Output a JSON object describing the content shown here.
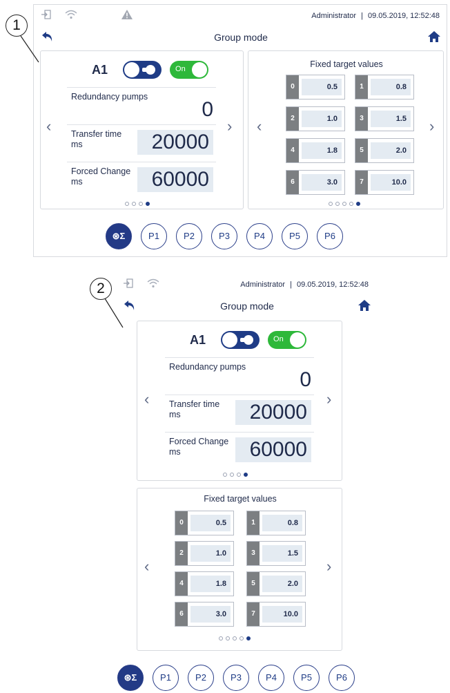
{
  "callouts": [
    "1",
    "2"
  ],
  "status": {
    "user": "Administrator",
    "separator": "|",
    "datetime": "09.05.2019, 12:52:48",
    "icons": [
      "login-icon",
      "wifi-icon",
      "warning-icon"
    ]
  },
  "header": {
    "title": "Group mode"
  },
  "group": {
    "label": "A1",
    "auto_toggle": "On"
  },
  "params": {
    "redundancy": {
      "label": "Redundancy pumps",
      "value": "0"
    },
    "transfer": {
      "label_line1": "Transfer time",
      "label_line2": "ms",
      "value": "20000"
    },
    "forced": {
      "label_line1": "Forced Change",
      "label_line2": "ms",
      "value": "60000"
    }
  },
  "fixed_targets": {
    "title": "Fixed target values",
    "items": [
      {
        "idx": "0",
        "val": "0.5"
      },
      {
        "idx": "1",
        "val": "0.8"
      },
      {
        "idx": "2",
        "val": "1.0"
      },
      {
        "idx": "3",
        "val": "1.5"
      },
      {
        "idx": "4",
        "val": "1.8"
      },
      {
        "idx": "5",
        "val": "2.0"
      },
      {
        "idx": "6",
        "val": "3.0"
      },
      {
        "idx": "7",
        "val": "10.0"
      }
    ]
  },
  "nav": {
    "prev": "‹",
    "next": "›"
  },
  "pumps": {
    "group_icon": "group-sum-icon",
    "group_label": "⊛Σ",
    "items": [
      "P1",
      "P2",
      "P3",
      "P4",
      "P5",
      "P6"
    ]
  },
  "colors": {
    "primary": "#1f3c86",
    "on_green": "#2eb83a",
    "value_bg": "#e4ebf2",
    "index_gray": "#7c7f82"
  }
}
